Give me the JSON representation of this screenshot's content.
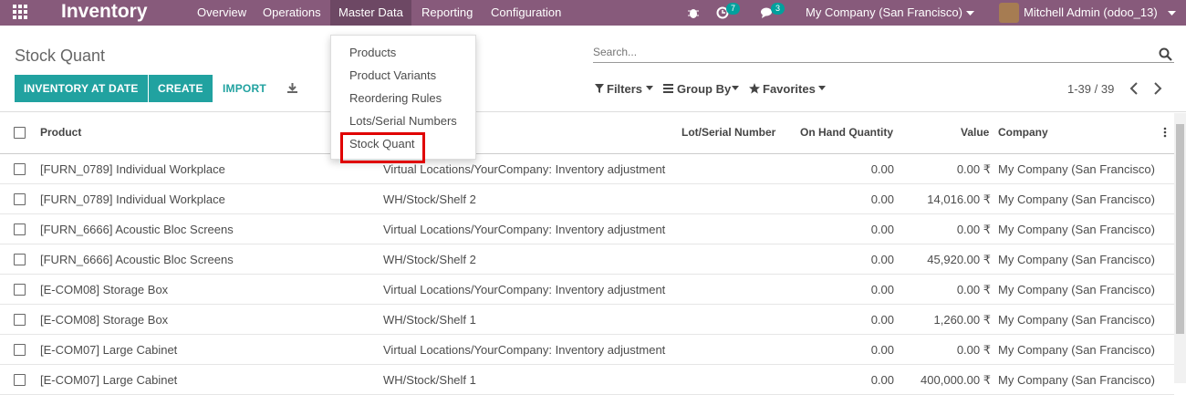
{
  "topbar": {
    "app_name": "Inventory",
    "menu": [
      "Overview",
      "Operations",
      "Master Data",
      "Reporting",
      "Configuration"
    ],
    "activity_count": "7",
    "message_count": "3",
    "company": "My Company (San Francisco)",
    "user": "Mitchell Admin (odoo_13)",
    "colors": {
      "bar": "#875a7b",
      "active": "#6d4864",
      "badge": "#01a09d"
    }
  },
  "control_panel": {
    "breadcrumb": "Stock Quant",
    "buttons": {
      "inventory_at_date": "INVENTORY AT DATE",
      "create": "CREATE",
      "import": "IMPORT"
    },
    "search_placeholder": "Search...",
    "filters": "Filters",
    "group_by": "Group By",
    "favorites": "Favorites",
    "pager": "1-39 / 39"
  },
  "dropdown": {
    "items": [
      "Products",
      "Product Variants",
      "Reordering Rules",
      "Lots/Serial Numbers",
      "Stock Quant"
    ],
    "highlighted": "Stock Quant"
  },
  "table": {
    "columns": [
      "Product",
      "Lot/Serial Number",
      "On Hand Quantity",
      "Value",
      "Company"
    ],
    "rows": [
      [
        "[FURN_0789] Individual Workplace",
        "Virtual Locations/YourCompany: Inventory adjustment",
        "0.00",
        "0.00 ₹",
        "My Company (San Francisco)"
      ],
      [
        "[FURN_0789] Individual Workplace",
        "WH/Stock/Shelf 2",
        "0.00",
        "14,016.00 ₹",
        "My Company (San Francisco)"
      ],
      [
        "[FURN_6666] Acoustic Bloc Screens",
        "Virtual Locations/YourCompany: Inventory adjustment",
        "0.00",
        "0.00 ₹",
        "My Company (San Francisco)"
      ],
      [
        "[FURN_6666] Acoustic Bloc Screens",
        "WH/Stock/Shelf 2",
        "0.00",
        "45,920.00 ₹",
        "My Company (San Francisco)"
      ],
      [
        "[E-COM08] Storage Box",
        "Virtual Locations/YourCompany: Inventory adjustment",
        "0.00",
        "0.00 ₹",
        "My Company (San Francisco)"
      ],
      [
        "[E-COM08] Storage Box",
        "WH/Stock/Shelf 1",
        "0.00",
        "1,260.00 ₹",
        "My Company (San Francisco)"
      ],
      [
        "[E-COM07] Large Cabinet",
        "Virtual Locations/YourCompany: Inventory adjustment",
        "0.00",
        "0.00 ₹",
        "My Company (San Francisco)"
      ],
      [
        "[E-COM07] Large Cabinet",
        "WH/Stock/Shelf 1",
        "0.00",
        "400,000.00 ₹",
        "My Company (San Francisco)"
      ]
    ]
  }
}
